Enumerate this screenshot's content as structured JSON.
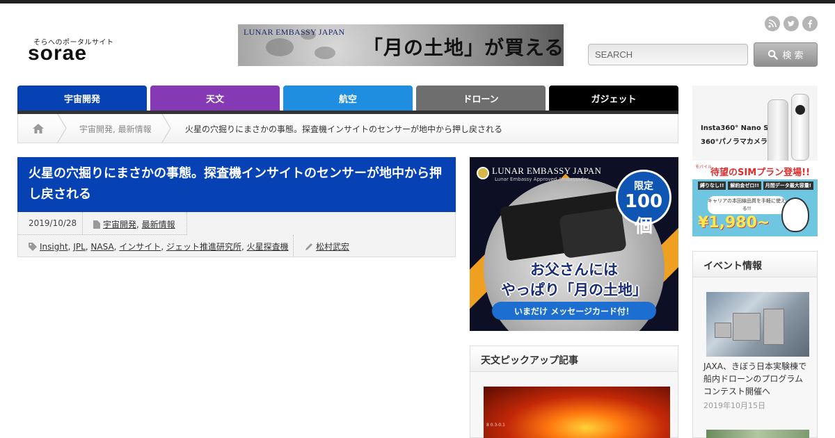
{
  "header": {
    "logo_tagline": "そらへのポータルサイト",
    "logo_word": "sorae",
    "top_banner": {
      "brand": "LUNAR EMBASSY JAPAN",
      "headline": "「月の土地」が買える！"
    },
    "social_icons": [
      "rss-icon",
      "twitter-icon",
      "facebook-icon"
    ],
    "search": {
      "placeholder": "SEARCH",
      "button_label": "検 索"
    }
  },
  "nav": {
    "tabs": [
      {
        "label": "宇宙開発",
        "color": "#0742b4"
      },
      {
        "label": "天文",
        "color": "#8539b5"
      },
      {
        "label": "航空",
        "color": "#1f8ee0"
      },
      {
        "label": "ドローン",
        "color": "#6e6e6e"
      },
      {
        "label": "ガジェット",
        "color": "#000000"
      }
    ]
  },
  "breadcrumb": {
    "category": "宇宙開発, 最新情報",
    "current": "火星の穴掘りにまさかの事態。探査機インサイトのセンサーが地中から押し戻される"
  },
  "article": {
    "title": "火星の穴掘りにまさかの事態。探査機インサイトのセンサーが地中から押し戻される",
    "date": "2019/10/28",
    "categories": [
      "宇宙開発",
      "最新情報"
    ],
    "tags": [
      "Insight",
      "JPL",
      "NASA",
      "インサイト",
      "ジェット推進研究所",
      "火星探査機"
    ],
    "author": "松村武宏"
  },
  "mid_ad": {
    "brand": "LUNAR EMBASSY JAPAN",
    "brand_sub": "Lunar Embassy Approved Ambassador",
    "badge_top": "限定",
    "badge_main": "100個",
    "line1": "お父さんには",
    "line2": "やっぱり「月の土地」",
    "pill": "いまだけ メッセージカード付！"
  },
  "astro_pickup": {
    "heading": "天文ピックアップ記事",
    "thumb_caption": "8 0.3-0.1"
  },
  "right_ads": {
    "camera": {
      "line1": "Insta360° Nano S",
      "line2": "360°パノラマカメラ"
    },
    "sim": {
      "small": "モバイル",
      "headline": "待望のSIMプラン登場!!",
      "chips": [
        "縛りなし!!",
        "解約金ゼロ!!",
        "月間データ最大容量!"
      ],
      "mid": "キャリアの本回線品質を手軽に使える!!",
      "price": "¥1,980~"
    }
  },
  "events": {
    "heading": "イベント情報",
    "items": [
      {
        "title": "JAXA、きぼう日本実験棟で船内ドローンのプログラムコンテスト開催へ",
        "date": "2019年10月15日"
      }
    ]
  },
  "colors": {
    "title_bar": "#0742b4",
    "nav_underline": "#333333"
  }
}
